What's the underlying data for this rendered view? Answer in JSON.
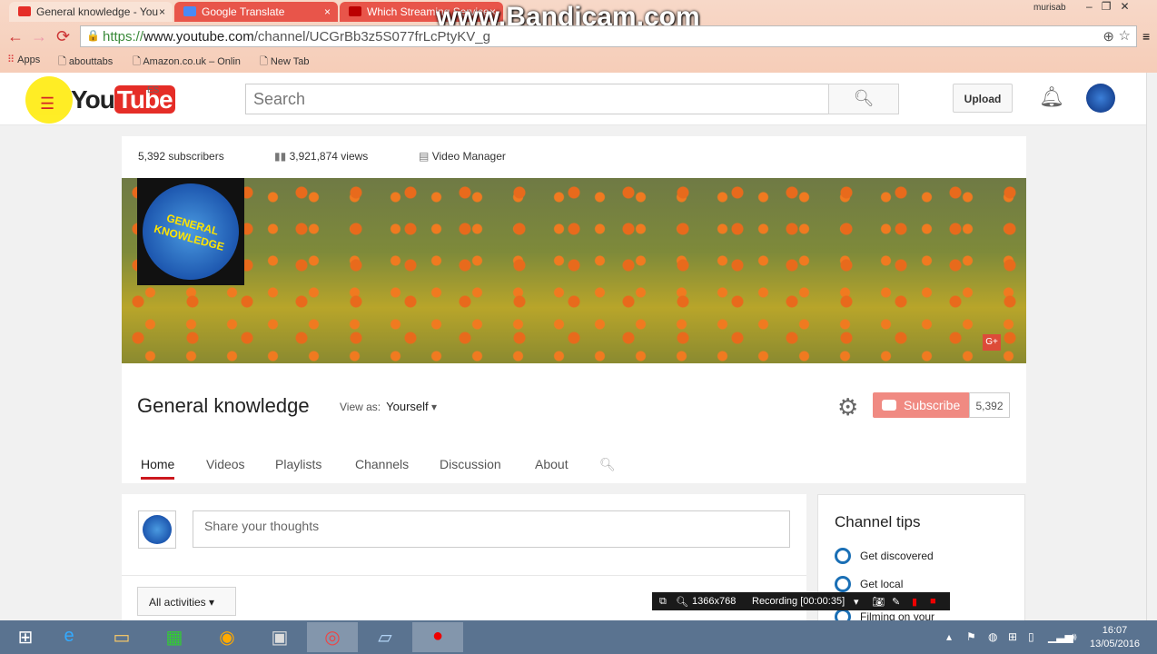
{
  "browser": {
    "tabs": [
      {
        "title": "General knowledge - You",
        "active": true,
        "close": "×"
      },
      {
        "title": "Google Translate",
        "active": false,
        "close": "×"
      },
      {
        "title": "Which Streaming Service",
        "active": false,
        "close": "×"
      }
    ],
    "watermark": "www.Bandicam.com",
    "user": "murisab",
    "url_scheme": "https://",
    "url_host": "www.youtube.com",
    "url_path": "/channel/UCGrBb3z5S077frLcPtyKV_g",
    "bookmarks": [
      "Apps",
      "abouttabs",
      "Amazon.co.uk – Onlin",
      "New Tab"
    ]
  },
  "youtube": {
    "logo_you": "You",
    "logo_tube": "Tube",
    "region": "ES",
    "search_placeholder": "Search",
    "upload": "Upload"
  },
  "channel": {
    "subscribers": "5,392 subscribers",
    "views": "3,921,874 views",
    "video_manager": "Video Manager",
    "logo_text": "GENERAL KNOWLEDGE",
    "gplus": "G+",
    "name": "General knowledge",
    "view_as_label": "View as:",
    "view_as_value": "Yourself",
    "subscribe": "Subscribe",
    "sub_count": "5,392",
    "tabs": [
      "Home",
      "Videos",
      "Playlists",
      "Channels",
      "Discussion",
      "About"
    ]
  },
  "feed": {
    "share_placeholder": "Share your thoughts",
    "filter": "All activities"
  },
  "tips": {
    "title": "Channel tips",
    "items": [
      "Get discovered",
      "Get local",
      "Filming on your"
    ]
  },
  "recorder": {
    "resolution": "1366x768",
    "status": "Recording [00:00:35]"
  },
  "taskbar": {
    "time": "16:07",
    "date": "13/05/2016"
  }
}
